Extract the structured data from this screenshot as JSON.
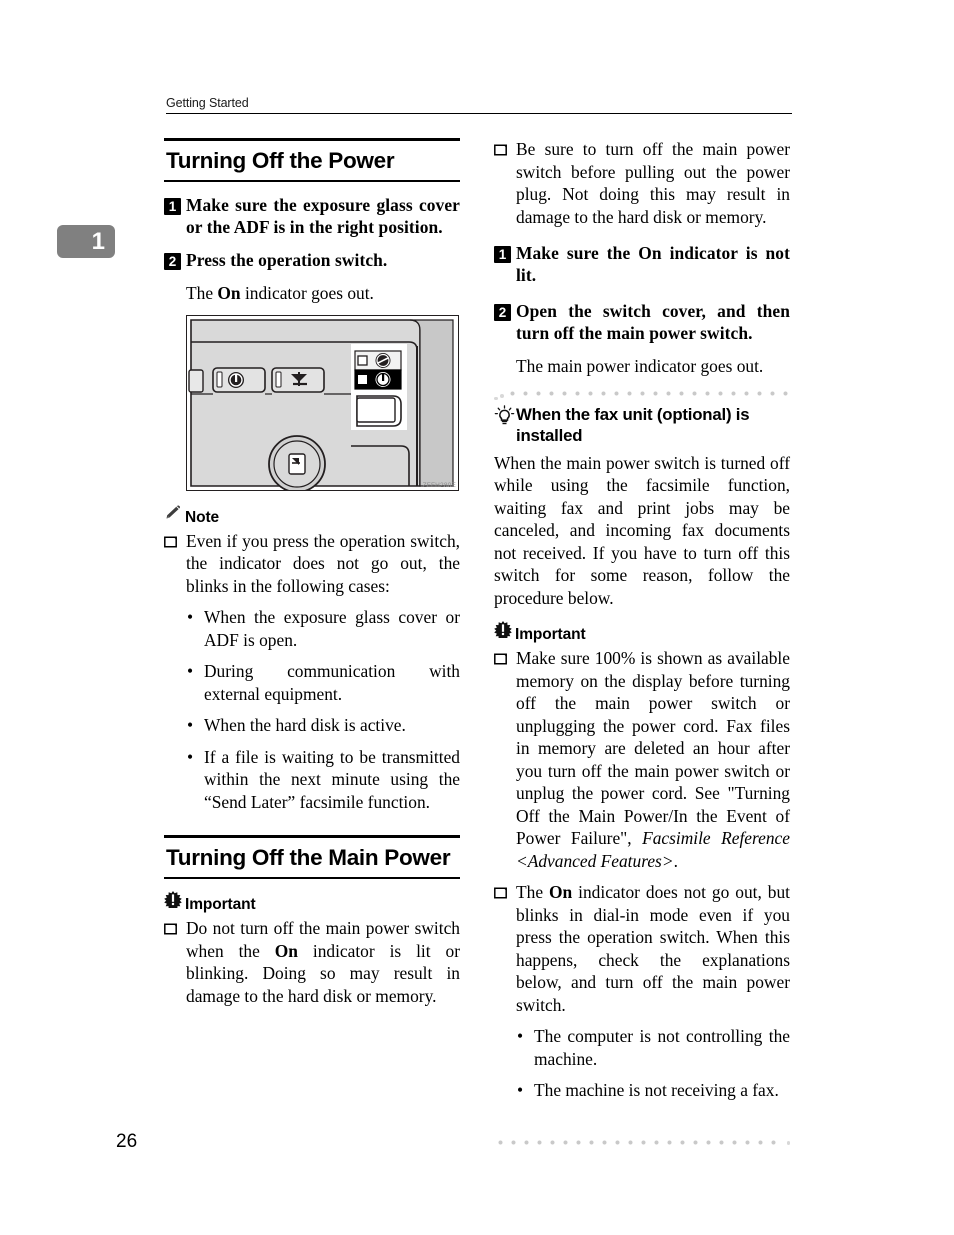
{
  "header": {
    "running_head": "Getting Started"
  },
  "chapter_tab": {
    "number": "1"
  },
  "folio": {
    "page_number": "26"
  },
  "left_column": {
    "section1": {
      "heading": "Turning Off the Power",
      "steps": [
        {
          "num": "1",
          "text": "Make sure the exposure glass cover or the ADF is in the right position."
        },
        {
          "num": "2",
          "text": "Press the operation switch.",
          "body_prefix": "The ",
          "body_bold": "On",
          "body_suffix": " indicator goes out."
        }
      ],
      "figure": {
        "id": "ZFFH280E"
      },
      "note": {
        "icon": "pencil-icon",
        "label": "Note",
        "items": [
          "Even if you press the operation switch, the indicator does not go out, the blinks in the following cases:"
        ],
        "sub_bullets": [
          "When the exposure glass cover or ADF is open.",
          "During communication with external equipment.",
          "When the hard disk is active.",
          "If a file is waiting to be transmitted within the next minute using the “Send Later” facsimile function."
        ]
      }
    },
    "section2": {
      "heading": "Turning Off the Main Power",
      "important": {
        "icon": "starburst-exclamation-icon",
        "label": "Important",
        "item_prefix": "Do not turn off the main power switch when the ",
        "item_bold": "On",
        "item_suffix": " indicator is lit or blinking. Doing so may result in damage to the hard disk or memory."
      }
    }
  },
  "right_column": {
    "top_checkbox_item": "Be sure to turn off the main power switch before pulling out the power plug. Not doing this may result in damage to the hard disk or memory.",
    "steps": [
      {
        "num": "1",
        "text": "Make sure the On indicator is not lit."
      },
      {
        "num": "2",
        "text": "Open the switch cover, and then turn off the main power switch.",
        "body": "The main power indicator goes out."
      }
    ],
    "tip": {
      "icon": "lightbulb-icon",
      "heading": "When the fax unit (optional) is installed",
      "body": "When the main power switch is turned off while using the facsimile function, waiting fax and print jobs may be canceled, and incoming fax documents not received. If you have to turn off this switch for some reason, follow the procedure below."
    },
    "important": {
      "icon": "starburst-exclamation-icon",
      "label": "Important",
      "item1_a": "Make sure 100% is shown as available memory on the display before turning off the main power switch or unplugging the power cord. Fax files in memory are deleted an hour after you turn off the main power switch or unplug the power cord. See \"Turning Off the Main Power/In the Event of Power Failure\", ",
      "item1_italic": "Facsimile Reference <Advanced Features>",
      "item1_b": ".",
      "item2_a": "The ",
      "item2_bold": "On",
      "item2_b": " indicator does not go out, but blinks in dial-in mode even if you press the operation switch. When this happens, check the explanations below, and turn off the main power switch.",
      "sub_bullets": [
        "The computer is not controlling the machine.",
        "The machine is not receiving a fax."
      ]
    }
  },
  "colors": {
    "chapter_tab_bg": "#808080",
    "rule": "#000000",
    "dot_gray": "#c9c9c9",
    "figure_line": "#231f20",
    "figure_fill": "#d6d6d6"
  }
}
